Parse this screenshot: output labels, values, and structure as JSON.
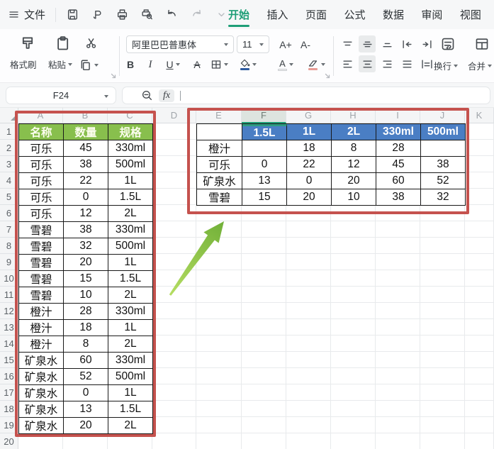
{
  "app_colors": {
    "accent_green": "#1E9E77",
    "table_header_green": "#88BF4D",
    "table_header_blue": "#4A7EC4",
    "annotation_red": "#C5524E",
    "arrow_green_light": "#B5DD62",
    "arrow_green_dark": "#71B038"
  },
  "menu_bar": {
    "file_menu": "文件"
  },
  "tabs": [
    {
      "label": "开始",
      "active": true
    },
    {
      "label": "插入",
      "active": false
    },
    {
      "label": "页面",
      "active": false
    },
    {
      "label": "公式",
      "active": false
    },
    {
      "label": "数据",
      "active": false
    },
    {
      "label": "审阅",
      "active": false
    },
    {
      "label": "视图",
      "active": false
    }
  ],
  "toolbar": {
    "format_painter_label": "格式刷",
    "paste_label": "粘贴",
    "font_name": "阿里巴巴普惠体",
    "font_size": "11",
    "bold_label": "B",
    "italic_label": "I",
    "underline_label": "U",
    "strike_label": "A",
    "font_bigger_label": "A+",
    "font_smaller_label": "A-",
    "font_color_label": "A",
    "wrap_label": "换行",
    "merge_label": "合并"
  },
  "formula_bar": {
    "cell_ref": "F24",
    "fx_label": "fx"
  },
  "grid": {
    "column_letters": [
      "A",
      "B",
      "C",
      "D",
      "E",
      "F",
      "G",
      "H",
      "I",
      "J",
      "K"
    ],
    "selected_column": "F",
    "row_count": 20
  },
  "source_table": {
    "headers": [
      "名称",
      "数量",
      "规格"
    ],
    "rows": [
      [
        "可乐",
        "45",
        "330ml"
      ],
      [
        "可乐",
        "38",
        "500ml"
      ],
      [
        "可乐",
        "22",
        "1L"
      ],
      [
        "可乐",
        "0",
        "1.5L"
      ],
      [
        "可乐",
        "12",
        "2L"
      ],
      [
        "雪碧",
        "38",
        "330ml"
      ],
      [
        "雪碧",
        "32",
        "500ml"
      ],
      [
        "雪碧",
        "20",
        "1L"
      ],
      [
        "雪碧",
        "15",
        "1.5L"
      ],
      [
        "雪碧",
        "10",
        "2L"
      ],
      [
        "橙汁",
        "28",
        "330ml"
      ],
      [
        "橙汁",
        "18",
        "1L"
      ],
      [
        "橙汁",
        "8",
        "2L"
      ],
      [
        "矿泉水",
        "60",
        "330ml"
      ],
      [
        "矿泉水",
        "52",
        "500ml"
      ],
      [
        "矿泉水",
        "0",
        "1L"
      ],
      [
        "矿泉水",
        "13",
        "1.5L"
      ],
      [
        "矿泉水",
        "20",
        "2L"
      ]
    ]
  },
  "pivot_table": {
    "corner": "",
    "col_headers": [
      "1.5L",
      "1L",
      "2L",
      "330ml",
      "500ml"
    ],
    "rows": [
      {
        "label": "橙汁",
        "values": [
          "",
          "18",
          "8",
          "28",
          ""
        ]
      },
      {
        "label": "可乐",
        "values": [
          "0",
          "22",
          "12",
          "45",
          "38"
        ]
      },
      {
        "label": "矿泉水",
        "values": [
          "13",
          "0",
          "20",
          "60",
          "52"
        ]
      },
      {
        "label": "雪碧",
        "values": [
          "15",
          "20",
          "10",
          "38",
          "32"
        ]
      }
    ]
  }
}
